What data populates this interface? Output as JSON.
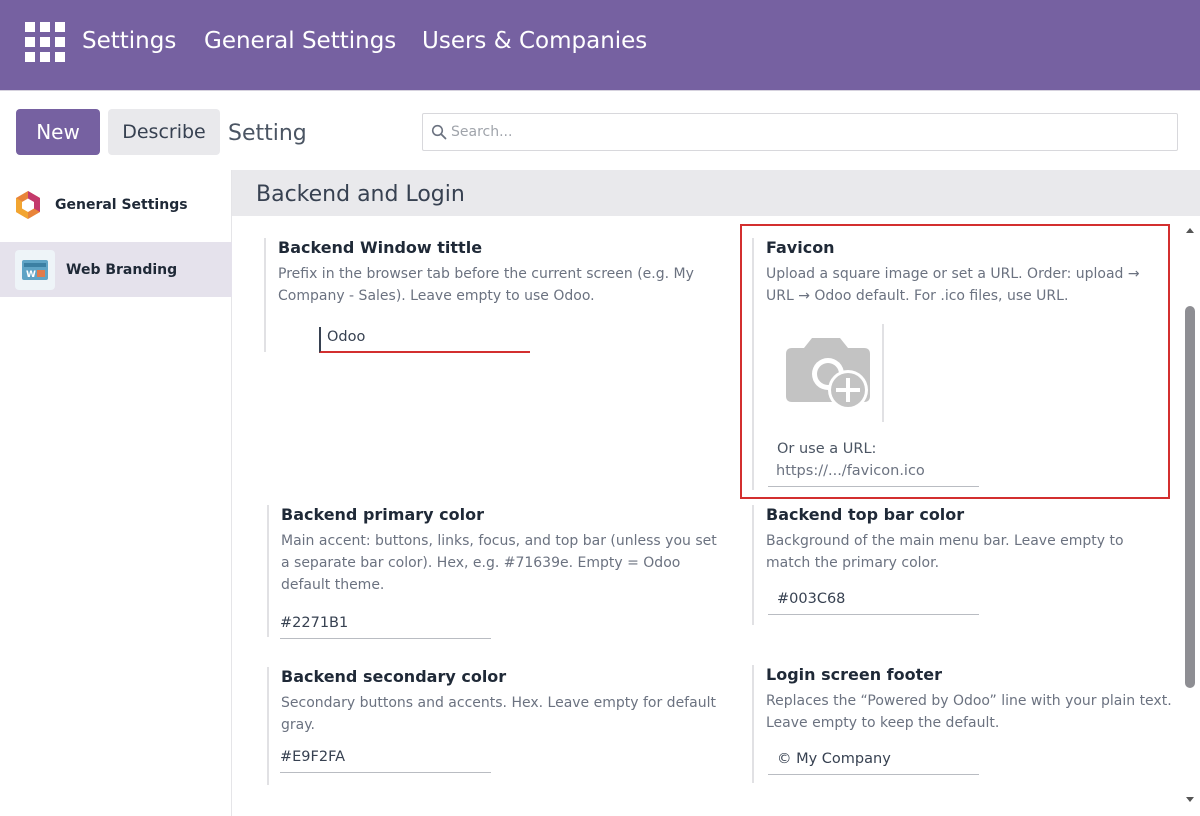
{
  "topbar": {
    "nav": [
      "Settings",
      "General Settings",
      "Users & Companies"
    ],
    "color": "#7661a1"
  },
  "control": {
    "new_label": "New",
    "describe_label": "Describe",
    "breadcrumb": "Setting",
    "search_placeholder": "Search..."
  },
  "sidebar": {
    "items": [
      {
        "label": "General Settings",
        "icon": "odoo-logo-icon"
      },
      {
        "label": "Web Branding",
        "icon": "web-branding-icon"
      }
    ]
  },
  "section": {
    "title": "Backend and Login"
  },
  "settings": {
    "window_title": {
      "title": "Backend Window tittle",
      "help": "Prefix in the browser tab before the current screen (e.g. My Company - Sales). Leave empty to use Odoo.",
      "value": "Odoo"
    },
    "favicon": {
      "title": "Favicon",
      "help": "Upload a square image or set a URL. Order: upload → URL → Odoo default. For .ico files, use URL.",
      "url_label": "Or use a URL:",
      "url_placeholder": "https://.../favicon.ico"
    },
    "primary_color": {
      "title": "Backend primary color",
      "help": "Main accent: buttons, links, focus, and top bar (unless you set a separate bar color). Hex, e.g. #71639e. Empty = Odoo default theme.",
      "value": "#2271B1"
    },
    "top_bar_color": {
      "title": "Backend top bar color",
      "help": "Background of the main menu bar. Leave empty to match the primary color.",
      "value": "#003C68"
    },
    "secondary_color": {
      "title": "Backend secondary color",
      "help": "Secondary buttons and accents. Hex. Leave empty for default gray.",
      "value": "#E9F2FA"
    },
    "login_footer": {
      "title": "Login screen footer",
      "help": "Replaces the “Powered by Odoo” line with your plain text. Leave empty to keep the default.",
      "value": "© My Company"
    }
  }
}
